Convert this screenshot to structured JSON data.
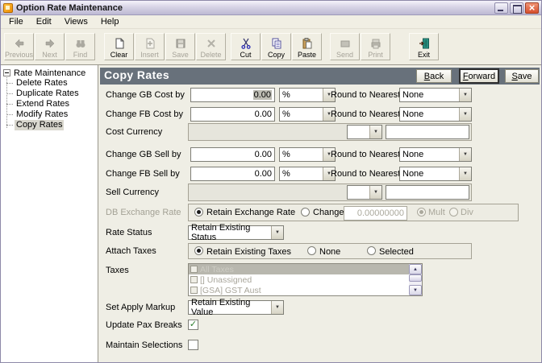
{
  "window": {
    "title": "Option Rate Maintenance",
    "controls": [
      "minimize",
      "maximize",
      "close"
    ]
  },
  "colors": {
    "titlebar": "#C9C6DB",
    "close_button": "#D64E2C",
    "page_header_bg": "#68717B",
    "page_header_text": "#FFFFFF",
    "form_bg": "#EFEEE5",
    "selection_gray": "#B8B7AE"
  },
  "menu": {
    "items": [
      "File",
      "Edit",
      "Views",
      "Help"
    ]
  },
  "toolbar": {
    "buttons": [
      {
        "label": "Previous",
        "icon": "hand-point-left-icon",
        "enabled": false
      },
      {
        "label": "Next",
        "icon": "hand-point-right-icon",
        "enabled": false
      },
      {
        "label": "Find",
        "icon": "binoculars-icon",
        "enabled": false
      },
      {
        "label": "Clear",
        "icon": "new-document-icon",
        "enabled": true
      },
      {
        "label": "Insert",
        "icon": "insert-page-icon",
        "enabled": false
      },
      {
        "label": "Save",
        "icon": "floppy-disk-icon",
        "enabled": false
      },
      {
        "label": "Delete",
        "icon": "delete-x-icon",
        "enabled": false
      },
      {
        "label": "Cut",
        "icon": "scissors-icon",
        "enabled": true
      },
      {
        "label": "Copy",
        "icon": "copy-pages-icon",
        "enabled": true
      },
      {
        "label": "Paste",
        "icon": "clipboard-paste-icon",
        "enabled": true
      },
      {
        "label": "Send",
        "icon": "send-icon",
        "enabled": false
      },
      {
        "label": "Print",
        "icon": "printer-icon",
        "enabled": false
      },
      {
        "label": "Exit",
        "icon": "exit-door-icon",
        "enabled": true
      }
    ]
  },
  "tree": {
    "root": "Rate Maintenance",
    "items": [
      {
        "label": "Delete Rates",
        "selected": false
      },
      {
        "label": "Duplicate Rates",
        "selected": false
      },
      {
        "label": "Extend Rates",
        "selected": false
      },
      {
        "label": "Modify Rates",
        "selected": false
      },
      {
        "label": "Copy Rates",
        "selected": true
      }
    ]
  },
  "page": {
    "title": "Copy Rates",
    "buttons": [
      {
        "label": "Back",
        "focused": false
      },
      {
        "label": "Forward",
        "focused": true
      },
      {
        "label": "Save",
        "focused": false
      }
    ]
  },
  "form": {
    "change_gb_cost": {
      "label": "Change GB Cost by",
      "value": "0.00",
      "unit": "%",
      "round_label": "Round to Nearest",
      "round_value": "None"
    },
    "change_fb_cost": {
      "label": "Change FB Cost by",
      "value": "0.00",
      "unit": "%",
      "round_label": "Round to Nearest",
      "round_value": "None"
    },
    "cost_currency": {
      "label": "Cost Currency",
      "currency_value": "",
      "amount_value": ""
    },
    "change_gb_sell": {
      "label": "Change GB Sell by",
      "value": "0.00",
      "unit": "%",
      "round_label": "Round to Nearest",
      "round_value": "None"
    },
    "change_fb_sell": {
      "label": "Change FB Sell by",
      "value": "0.00",
      "unit": "%",
      "round_label": "Round to Nearest",
      "round_value": "None"
    },
    "sell_currency": {
      "label": "Sell Currency",
      "currency_value": "",
      "amount_value": ""
    },
    "db_exchange_rate": {
      "label": "DB Exchange Rate",
      "retain_option": "Retain Exchange Rate",
      "change_option": "Change to",
      "change_value": "0.00000000",
      "mult_option": "Mult",
      "div_option": "Div",
      "selected": "Retain Exchange Rate",
      "disabled": true
    },
    "rate_status": {
      "label": "Rate Status",
      "value": "Retain Existing Status"
    },
    "attach_taxes": {
      "label": "Attach Taxes",
      "options": [
        "Retain Existing Taxes",
        "None",
        "Selected"
      ],
      "selected": "Retain Existing Taxes"
    },
    "taxes": {
      "label": "Taxes",
      "disabled": true,
      "items": [
        {
          "label": "All Taxes",
          "checked": false,
          "highlighted": true
        },
        {
          "label": "[] Unassigned",
          "checked": false,
          "highlighted": false
        },
        {
          "label": "[GSA] GST Aust",
          "checked": false,
          "highlighted": false
        }
      ]
    },
    "set_apply_markup": {
      "label": "Set Apply Markup",
      "value": "Retain Existing Value"
    },
    "update_pax_breaks": {
      "label": "Update Pax Breaks",
      "checked": true
    },
    "maintain_selections": {
      "label": "Maintain Selections",
      "checked": false
    }
  }
}
